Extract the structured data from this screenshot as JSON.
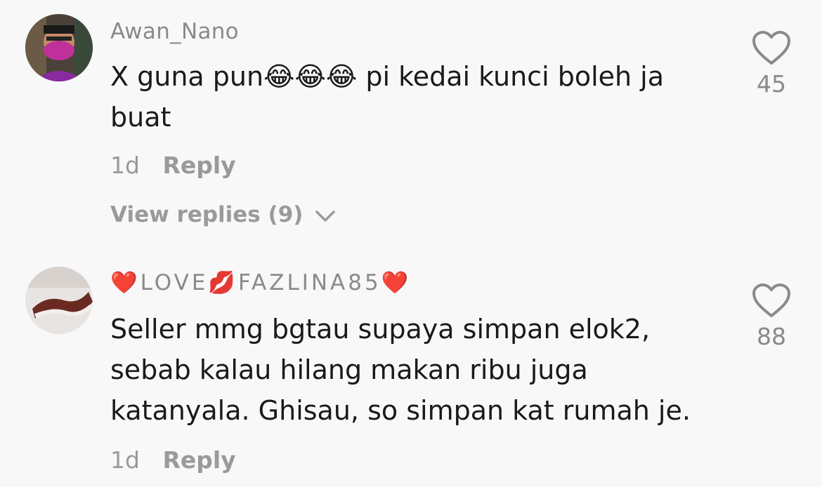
{
  "comments": [
    {
      "username": "Awan_Nano",
      "text": "X guna pun😂😂😂 pi kedai kunci boleh ja buat",
      "time": "1d",
      "reply_label": "Reply",
      "view_replies": "View replies (9)",
      "likes": "45"
    },
    {
      "username": "❤️LOVE💋FAZLINA85❤️",
      "text": "Seller mmg bgtau supaya simpan elok2, sebab kalau hilang makan ribu juga katanyala. Ghisau, so simpan kat rumah je.",
      "time": "1d",
      "reply_label": "Reply",
      "likes": "88"
    }
  ],
  "icons": {
    "like": "heart-outline-icon",
    "expand": "chevron-down-icon"
  },
  "colors": {
    "background": "#f8f8f8",
    "muted": "#8a8a8a",
    "text": "#1a1a1a"
  }
}
